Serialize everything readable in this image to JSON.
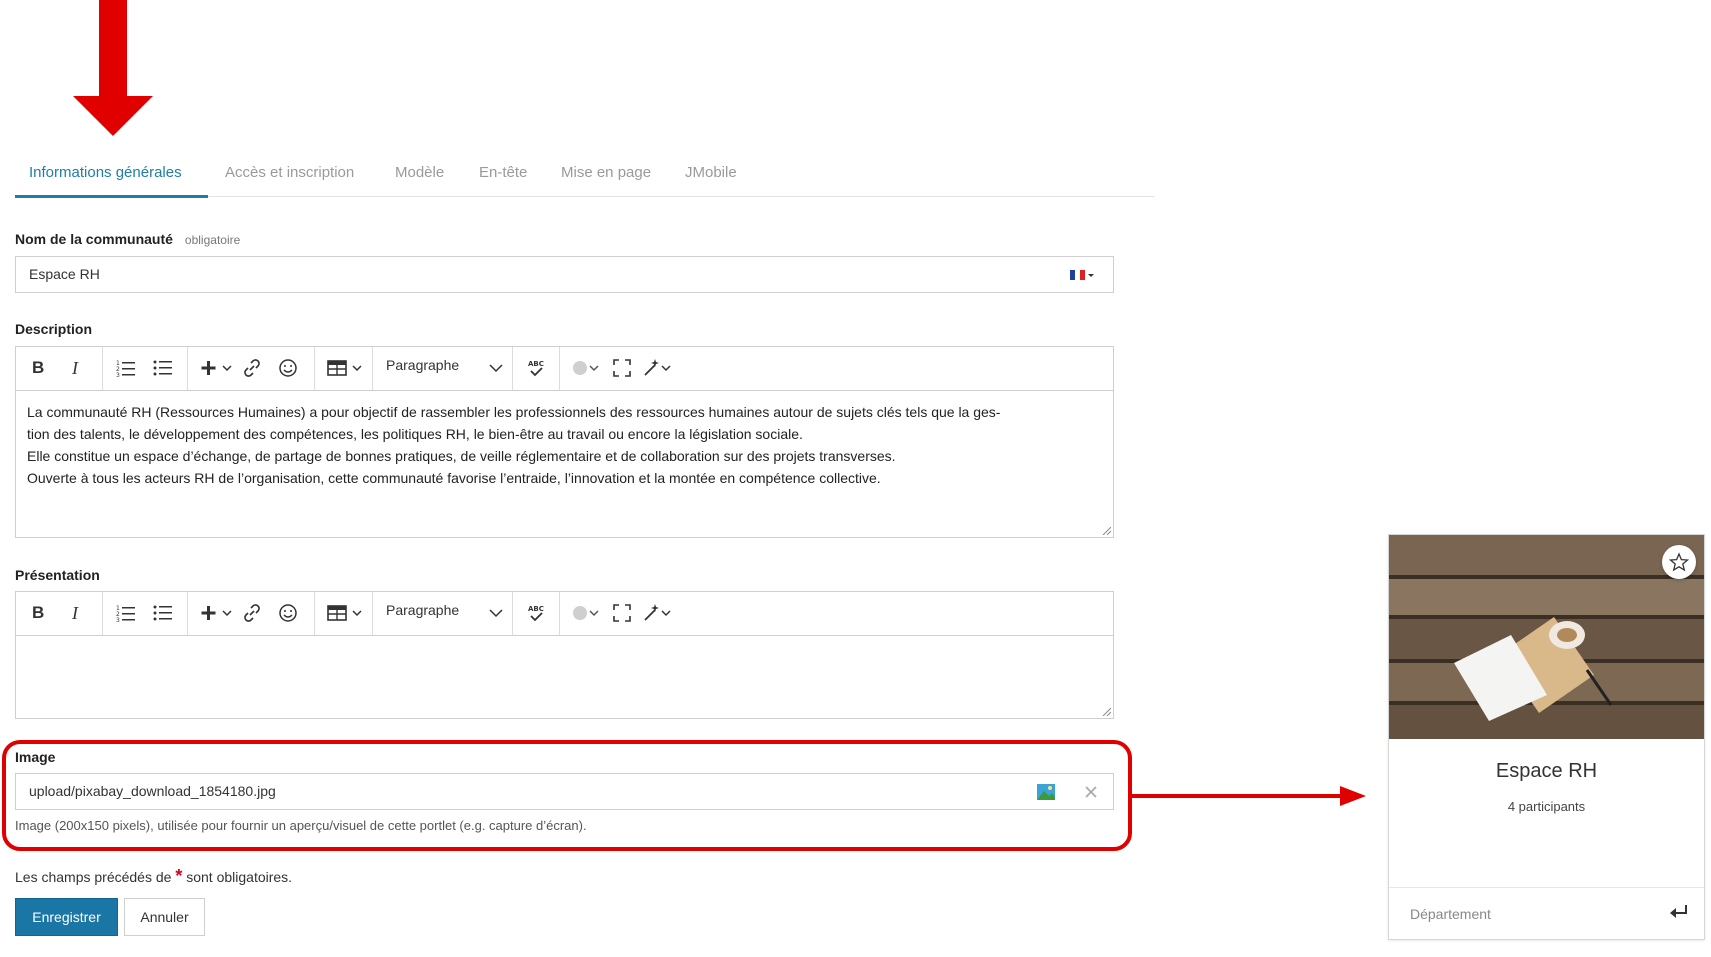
{
  "tabs": [
    {
      "label": "Informations générales"
    },
    {
      "label": "Accès et inscription"
    },
    {
      "label": "Modèle"
    },
    {
      "label": "En-tête"
    },
    {
      "label": "Mise en page"
    },
    {
      "label": "JMobile"
    }
  ],
  "name_field": {
    "label": "Nom de la communauté",
    "required_hint": "obligatoire",
    "value": "Espace RH",
    "language_flag": "french-flag-icon"
  },
  "description": {
    "label": "Description",
    "paragraph_select": "Paragraphe",
    "lines": [
      "La communauté RH (Ressources Humaines) a pour objectif de rassembler les professionnels des ressources humaines autour de sujets clés tels que la ges-",
      "tion des talents, le développement des compétences, les politiques RH, le bien-être au travail ou encore la législation sociale.",
      "Elle constitue un espace d’échange, de partage de bonnes pratiques, de veille réglementaire et de collaboration sur des projets transverses.",
      "Ouverte à tous les acteurs RH de l’organisation, cette communauté favorise l’entraide, l’innovation et la montée en compétence collective."
    ]
  },
  "presentation": {
    "label": "Présentation",
    "paragraph_select": "Paragraphe"
  },
  "image_field": {
    "label": "Image",
    "value": "upload/pixabay_download_1854180.jpg",
    "help": "Image (200x150 pixels), utilisée pour fournir un aperçu/visuel de cette portlet (e.g. capture d’écran)."
  },
  "required_note": {
    "before": "Les champs précédés de",
    "star": "*",
    "after": "sont obligatoires."
  },
  "buttons": {
    "save": "Enregistrer",
    "cancel": "Annuler"
  },
  "card": {
    "title": "Espace RH",
    "participants": "4 participants",
    "footer": "Département"
  },
  "colors": {
    "accent": "#1f7ea7",
    "primary_button": "#1a76a4",
    "highlight_red": "#e00000"
  }
}
